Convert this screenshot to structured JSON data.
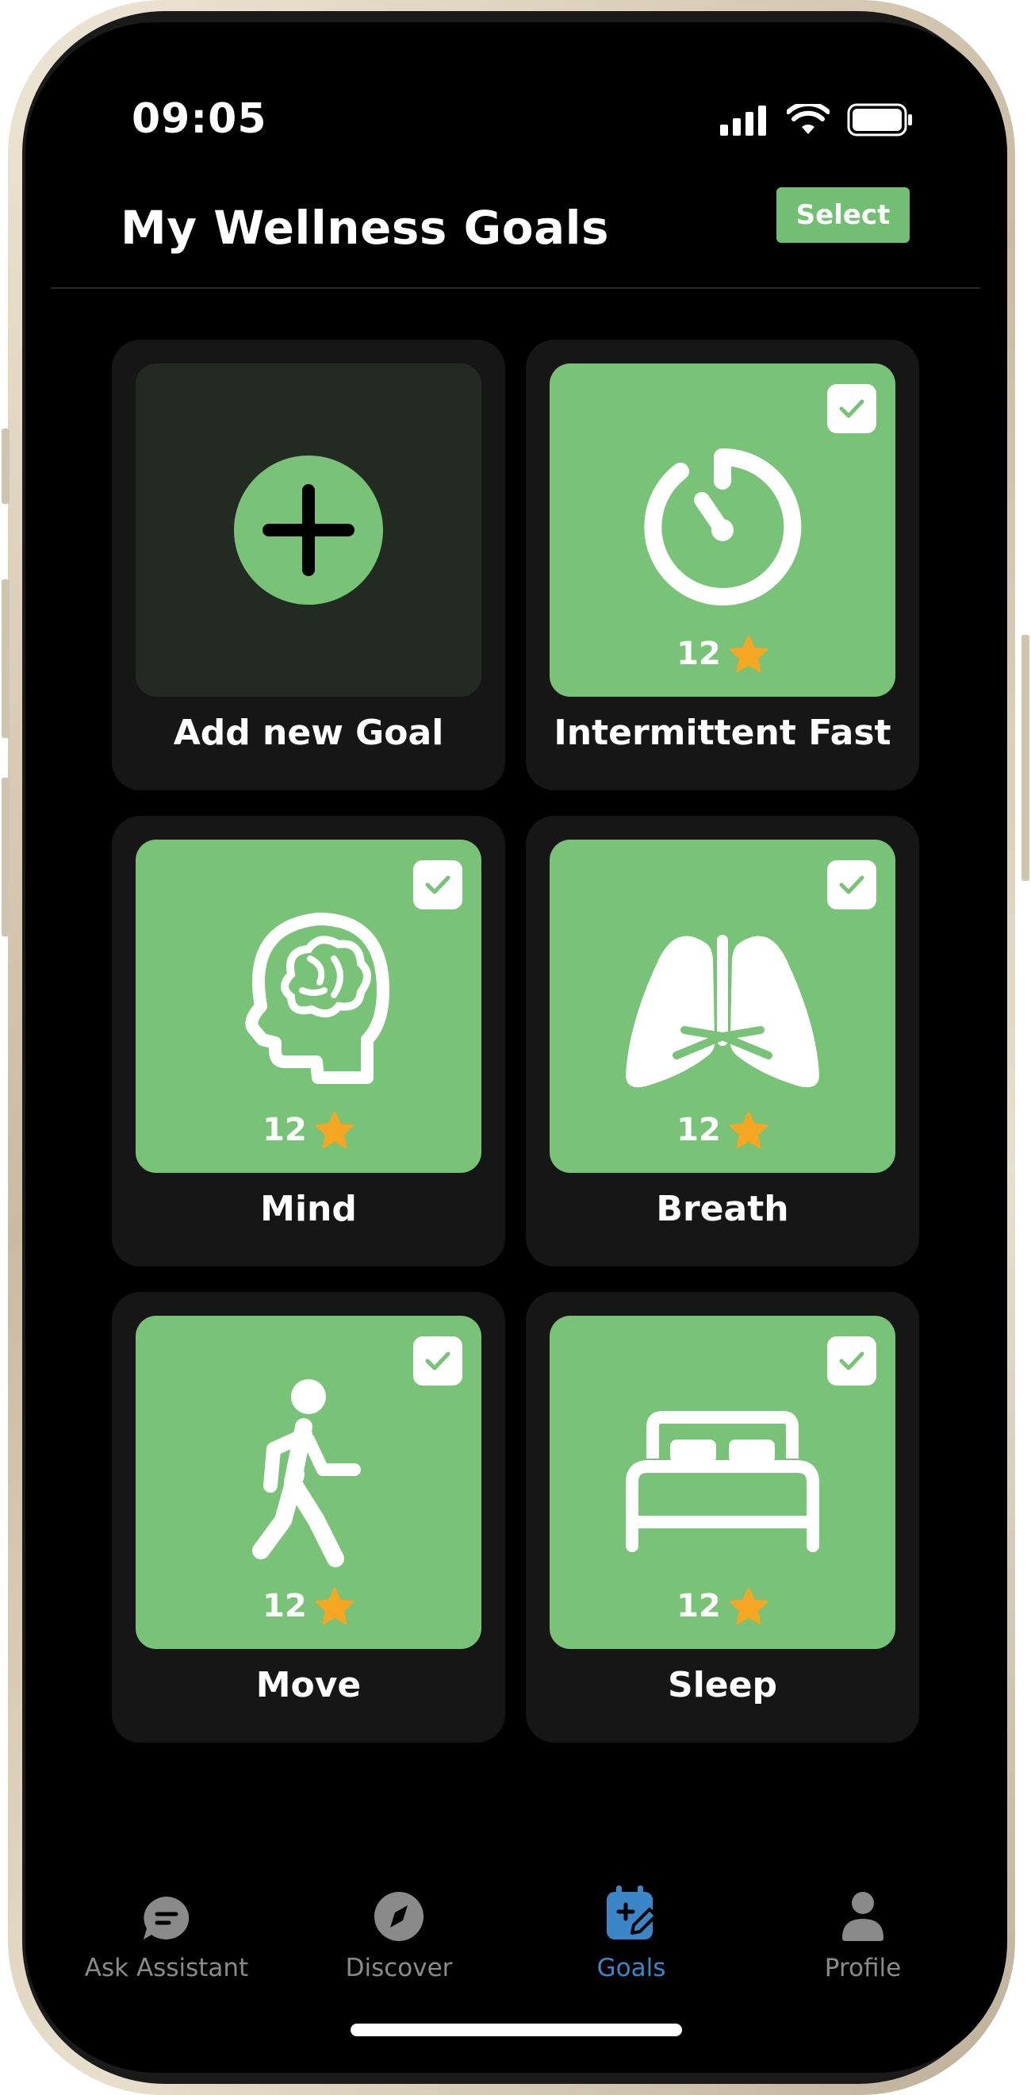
{
  "status_bar": {
    "time": "09:05"
  },
  "header": {
    "title": "My Wellness Goals",
    "select_label": "Select"
  },
  "goals": [
    {
      "label": "Add new Goal",
      "icon": "plus-icon",
      "is_add": true
    },
    {
      "label": "Intermittent Fast",
      "icon": "timer-icon",
      "checked": true,
      "rating": "12"
    },
    {
      "label": "Mind",
      "icon": "brain-head-icon",
      "checked": true,
      "rating": "12"
    },
    {
      "label": "Breath",
      "icon": "lungs-icon",
      "checked": true,
      "rating": "12"
    },
    {
      "label": "Move",
      "icon": "walking-person-icon",
      "checked": true,
      "rating": "12"
    },
    {
      "label": "Sleep",
      "icon": "bed-icon",
      "checked": true,
      "rating": "12"
    }
  ],
  "tabs": [
    {
      "label": "Ask Assistant",
      "icon": "chat-bubble-icon",
      "active": false
    },
    {
      "label": "Discover",
      "icon": "compass-icon",
      "active": false
    },
    {
      "label": "Goals",
      "icon": "calendar-edit-icon",
      "active": true
    },
    {
      "label": "Profile",
      "icon": "person-icon",
      "active": false
    }
  ],
  "colors": {
    "accent_green": "#78c378",
    "active_tab_blue": "#3b86c7",
    "star_orange": "#f5a623",
    "background": "#000000",
    "card": "#161616"
  }
}
